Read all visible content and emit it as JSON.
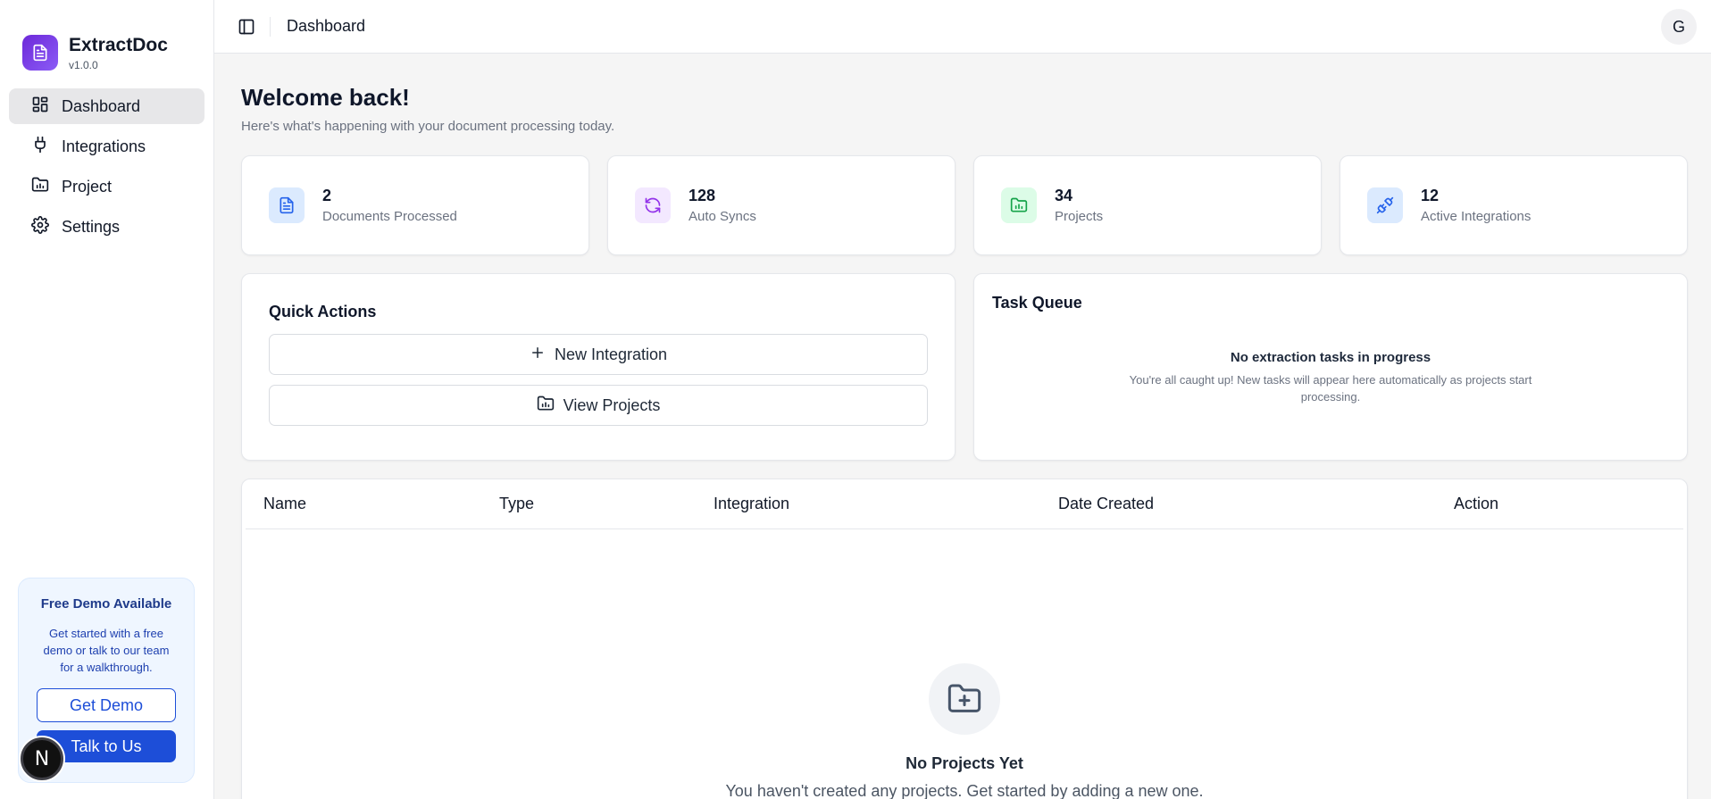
{
  "brand": {
    "name": "ExtractDoc",
    "version": "v1.0.0",
    "color": "#7c3aed"
  },
  "sidebar": {
    "items": [
      {
        "label": "Dashboard",
        "icon": "dashboard-grid-icon",
        "active": true
      },
      {
        "label": "Integrations",
        "icon": "plug-icon",
        "active": false
      },
      {
        "label": "Project",
        "icon": "folder-chart-icon",
        "active": false
      },
      {
        "label": "Settings",
        "icon": "gear-icon",
        "active": false
      }
    ],
    "demo": {
      "title": "Free Demo Available",
      "description": "Get started with a free demo or talk to our team for a walkthrough.",
      "primary_label": "Get Demo",
      "secondary_label": "Talk to Us"
    },
    "badge_letter": "N"
  },
  "topbar": {
    "title": "Dashboard",
    "avatar_letter": "G"
  },
  "welcome": {
    "title": "Welcome back!",
    "subtitle": "Here's what's happening with your document processing today."
  },
  "stats": [
    {
      "value": "2",
      "label": "Documents Processed",
      "icon": "document-icon",
      "color": "#2563eb"
    },
    {
      "value": "128",
      "label": "Auto Syncs",
      "icon": "refresh-icon",
      "color": "#9333ea"
    },
    {
      "value": "34",
      "label": "Projects",
      "icon": "folder-chart-icon",
      "color": "#16a34a"
    },
    {
      "value": "12",
      "label": "Active Integrations",
      "icon": "plug-icon",
      "color": "#2563eb"
    }
  ],
  "quick_actions": {
    "title": "Quick Actions",
    "buttons": [
      {
        "label": "New Integration",
        "icon": "plus-icon"
      },
      {
        "label": "View Projects",
        "icon": "folder-chart-icon"
      }
    ]
  },
  "task_queue": {
    "title": "Task Queue",
    "empty_title": "No extraction tasks in progress",
    "empty_description": "You're all caught up! New tasks will appear here automatically as projects start processing."
  },
  "projects_table": {
    "columns": [
      "Name",
      "Type",
      "Integration",
      "Date Created",
      "Action"
    ],
    "empty_title": "No Projects Yet",
    "empty_description": "You haven't created any projects. Get started by adding a new one."
  }
}
